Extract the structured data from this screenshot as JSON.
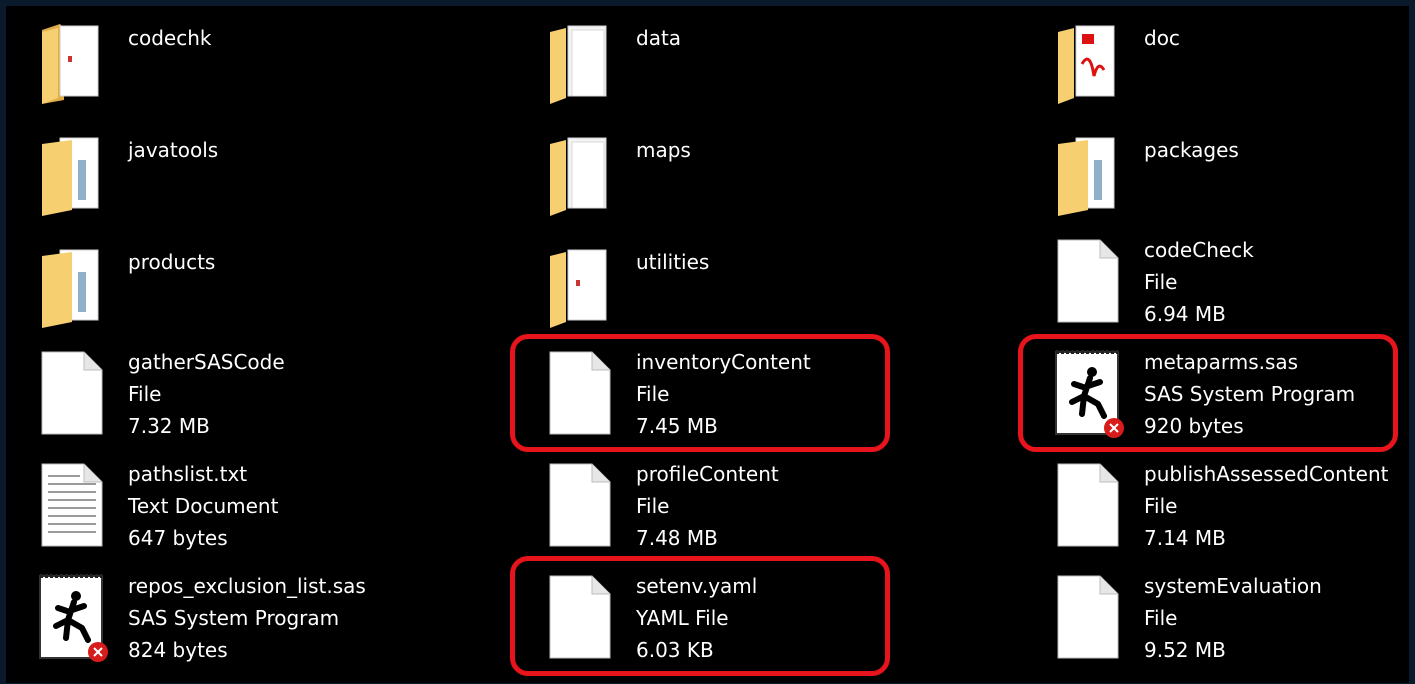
{
  "items": [
    {
      "name": "codechk",
      "type": "",
      "size": "",
      "icon": "folder-icon"
    },
    {
      "name": "data",
      "type": "",
      "size": "",
      "icon": "folder-icon"
    },
    {
      "name": "doc",
      "type": "",
      "size": "",
      "icon": "folder-icon"
    },
    {
      "name": "javatools",
      "type": "",
      "size": "",
      "icon": "folder-icon"
    },
    {
      "name": "maps",
      "type": "",
      "size": "",
      "icon": "folder-icon"
    },
    {
      "name": "packages",
      "type": "",
      "size": "",
      "icon": "folder-icon"
    },
    {
      "name": "products",
      "type": "",
      "size": "",
      "icon": "folder-icon"
    },
    {
      "name": "utilities",
      "type": "",
      "size": "",
      "icon": "folder-icon"
    },
    {
      "name": "codeCheck",
      "type": "File",
      "size": "6.94 MB",
      "icon": "file-icon"
    },
    {
      "name": "gatherSASCode",
      "type": "File",
      "size": "7.32 MB",
      "icon": "file-icon"
    },
    {
      "name": "inventoryContent",
      "type": "File",
      "size": "7.45 MB",
      "icon": "file-icon"
    },
    {
      "name": "metaparms.sas",
      "type": "SAS System Program",
      "size": "920 bytes",
      "icon": "sas-program-icon"
    },
    {
      "name": "pathslist.txt",
      "type": "Text Document",
      "size": "647 bytes",
      "icon": "text-document-icon"
    },
    {
      "name": "profileContent",
      "type": "File",
      "size": "7.48 MB",
      "icon": "file-icon"
    },
    {
      "name": "publishAssessedContent",
      "type": "File",
      "size": "7.14 MB",
      "icon": "file-icon"
    },
    {
      "name": "repos_exclusion_list.sas",
      "type": "SAS System Program",
      "size": "824 bytes",
      "icon": "sas-program-icon"
    },
    {
      "name": "setenv.yaml",
      "type": "YAML File",
      "size": "6.03 KB",
      "icon": "file-icon"
    },
    {
      "name": "systemEvaluation",
      "type": "File",
      "size": "9.52 MB",
      "icon": "file-icon"
    }
  ],
  "colors": {
    "background": "#000000",
    "text": "#ffffff",
    "highlight": "#e8141b",
    "folder": "#f2c766"
  }
}
